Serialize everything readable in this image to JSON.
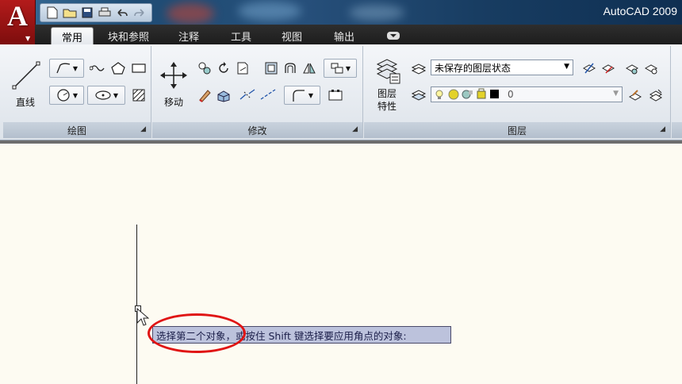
{
  "app": {
    "title": "AutoCAD 2009"
  },
  "quick_access": [
    {
      "name": "new-file-icon"
    },
    {
      "name": "open-folder-icon"
    },
    {
      "name": "save-icon"
    },
    {
      "name": "print-icon"
    },
    {
      "name": "undo-icon"
    },
    {
      "name": "redo-icon"
    }
  ],
  "tabs": {
    "home": "常用",
    "blocks": "块和参照",
    "annotate": "注释",
    "tools": "工具",
    "view": "视图",
    "output": "输出"
  },
  "panels": {
    "draw": {
      "title": "绘图",
      "line_label": "直线"
    },
    "modify": {
      "title": "修改",
      "move_label": "移动"
    },
    "layers": {
      "title": "图层",
      "properties_label_1": "图层",
      "properties_label_2": "特性",
      "state_value": "未保存的图层状态",
      "layer_value": "0"
    }
  },
  "prompt": {
    "text": "选择第二个对象，或按住 Shift 键选择要应用角点的对象:"
  },
  "colors": {
    "accent_red": "#e01414",
    "ribbon_bg": "#e6ebf1",
    "canvas_bg": "#fdfbf2"
  }
}
